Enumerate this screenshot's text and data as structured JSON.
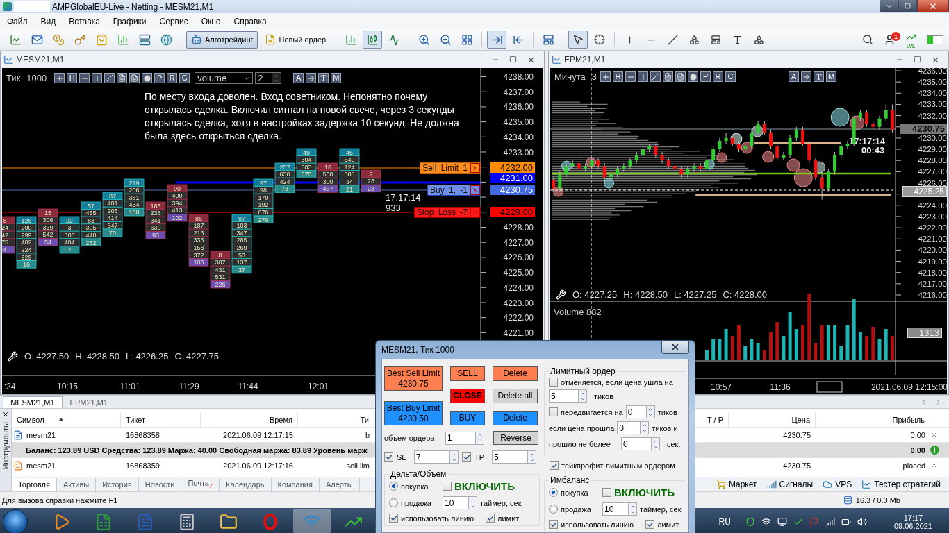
{
  "window": {
    "title": "AMPGlobalEU-Live - Netting - MESM21,M1"
  },
  "menu": [
    "Файл",
    "Вид",
    "Вставка",
    "Графики",
    "Сервис",
    "Окно",
    "Справка"
  ],
  "toolbar": {
    "buttons": [
      {
        "label": "Алготрейдинг",
        "selected": true
      },
      {
        "label": "Новый ордер",
        "selected": false
      }
    ],
    "chart_type": [
      {
        "selected": false
      },
      {
        "selected": true
      },
      {
        "selected": false
      }
    ],
    "scroll": [
      {
        "selected": true
      },
      {
        "selected": false
      }
    ],
    "cursor_tools": [
      {
        "selected": true
      },
      {
        "selected": false
      }
    ],
    "notification_count": "1",
    "level_badge": "LVL"
  },
  "left_chart": {
    "title": "MESM21,M1",
    "timeframe_label": "Тик",
    "timeframe_value": "1000",
    "tools": [
      {
        "kind": "plus"
      },
      {
        "kind": "letter",
        "label": "H"
      },
      {
        "kind": "hline"
      },
      {
        "kind": "vline"
      },
      {
        "kind": "diag"
      },
      {
        "kind": "lines"
      },
      {
        "kind": "lines"
      },
      {
        "kind": "dot"
      },
      {
        "kind": "letter",
        "label": "P"
      },
      {
        "kind": "letter",
        "label": "R"
      },
      {
        "kind": "letter",
        "label": "C"
      }
    ],
    "indicator": "volume",
    "indicator_value": "2",
    "tools_right": [
      {
        "kind": "letter",
        "label": "A"
      },
      {
        "kind": "arrow"
      },
      {
        "kind": "ibeam"
      },
      {
        "kind": "letter",
        "label": "M"
      }
    ],
    "note": "По месту входа доволен. Вход советником. Непонятно почему открылась сделка. Включил сигнал на новой свече, через 3 секунды открылась сделка, хотя в настройках задержка 10 секунд. Не должна была здесь открыться сделка.",
    "price_axis": [
      [
        "4238.00",
        "4237.00",
        "4236.00",
        "4235.00",
        "4234.00",
        "4233.00"
      ],
      [
        "4228.00",
        "4227.00",
        "4226.00",
        "4225.00",
        "4224.00",
        "4223.00",
        "4222.00",
        "4221.00"
      ]
    ],
    "order_lines": [
      {
        "kind": "sell_limit",
        "label": "Sell Limit 1",
        "price": "4232.00"
      },
      {
        "kind": "buy",
        "label": "Buy 1, -1",
        "price": "4230.75"
      },
      {
        "kind": "stop_loss",
        "label": "Stop Loss -7",
        "price": "4229.00"
      }
    ],
    "extra_tag": "4231.00",
    "clock": "17:17:14",
    "tick_volume": "933",
    "ohlc": [
      "O: 4227.50",
      "H: 4228.50",
      "L: 4226.25",
      "C: 4227.75"
    ],
    "time_axis": [
      ":24",
      "10:15",
      "11:01",
      "11:29",
      "11:44",
      "12:01"
    ],
    "clusters": [
      {
        "kind": "down",
        "cells": [
          "8",
          "24",
          "42",
          "75",
          "4"
        ]
      },
      {
        "kind": "up",
        "cells": [
          "126",
          "200",
          "299",
          "402",
          "224",
          "229",
          "16"
        ]
      },
      {
        "kind": "down",
        "cells": [
          "15",
          "306",
          "339",
          "542",
          "54"
        ]
      },
      {
        "kind": "up",
        "cells": [
          "22",
          "3",
          "305",
          "404",
          "7"
        ]
      },
      {
        "kind": "up",
        "cells": [
          "57",
          "455",
          "83",
          "305",
          "448",
          "232"
        ]
      },
      {
        "kind": "up",
        "cells": [
          "87",
          "401",
          "206",
          "414",
          "347",
          "70"
        ]
      },
      {
        "kind": "up",
        "cells": [
          "219",
          "206",
          "381",
          "434",
          "108"
        ]
      },
      {
        "kind": "down",
        "cells": [
          "185",
          "238",
          "341",
          "630",
          "93"
        ]
      },
      {
        "kind": "down",
        "cells": [
          "90",
          "400",
          "394",
          "413",
          "102"
        ]
      },
      {
        "kind": "down",
        "cells": [
          "86",
          "187",
          "216",
          "336",
          "158",
          "372",
          "106"
        ]
      },
      {
        "kind": "down",
        "cells": [
          "8",
          "307",
          "431",
          "531",
          "226"
        ]
      },
      {
        "kind": "up",
        "cells": [
          "97",
          "103",
          "347",
          "285",
          "269",
          "53",
          "137",
          "37"
        ]
      },
      {
        "kind": "up",
        "cells": [
          "97",
          "98",
          "170",
          "192",
          "676",
          "276"
        ]
      },
      {
        "kind": "up",
        "cells": [
          "257",
          "630",
          "424",
          "73"
        ]
      },
      {
        "kind": "up",
        "cells": [
          "49",
          "304",
          "503",
          "575"
        ]
      },
      {
        "kind": "down",
        "cells": [
          "16",
          "560",
          "300",
          "457"
        ]
      },
      {
        "kind": "up",
        "cells": [
          "45",
          "540",
          "124",
          "388",
          "34",
          "21"
        ]
      },
      {
        "kind": "down",
        "cells": [
          "2",
          "23",
          "23"
        ]
      }
    ]
  },
  "right_chart": {
    "title": "EPM21,M1",
    "timeframe_label": "Минута",
    "timeframe_value": "3",
    "tools": [
      {
        "kind": "plus"
      },
      {
        "kind": "letter",
        "label": "H"
      },
      {
        "kind": "hline"
      },
      {
        "kind": "vline"
      },
      {
        "kind": "diag"
      },
      {
        "kind": "lines"
      },
      {
        "kind": "lines"
      },
      {
        "kind": "dot"
      },
      {
        "kind": "letter",
        "label": "P"
      },
      {
        "kind": "letter",
        "label": "R"
      },
      {
        "kind": "letter",
        "label": "C"
      }
    ],
    "tools_right": [
      {
        "kind": "letter",
        "label": "A"
      },
      {
        "kind": "arrow"
      },
      {
        "kind": "ibeam"
      },
      {
        "kind": "letter",
        "label": "M"
      }
    ],
    "last_price": "4230.75",
    "cursor_price": "4225.25",
    "clock": "17:17:14",
    "timer": "00:43",
    "ohlc": [
      "O: 4227.25",
      "H: 4228.50",
      "L: 4227.25",
      "C: 4228.00"
    ],
    "volume_label": "Volume 882",
    "volume_tag": "1313",
    "time_axis": [
      "10:57",
      "11:36"
    ],
    "time_stamp": "2021.06.09 12:15:00",
    "chart_data": {
      "type": "candlestick",
      "ylim": [
        4216,
        4236
      ],
      "yticks": [
        {
          "value": 4236,
          "label": "4236.00"
        },
        {
          "value": 4235,
          "label": "4235.00"
        },
        {
          "value": 4234,
          "label": "4234.00"
        },
        {
          "value": 4233,
          "label": "4233.00"
        },
        {
          "value": 4232,
          "label": "4232.00"
        },
        {
          "value": 4230,
          "label": "4230.00"
        },
        {
          "value": 4229,
          "label": "4229.00"
        },
        {
          "value": 4228,
          "label": "4228.00"
        },
        {
          "value": 4227,
          "label": "4227.00"
        },
        {
          "value": 4226,
          "label": "4226.00"
        },
        {
          "value": 4224,
          "label": "4224.00"
        },
        {
          "value": 4223,
          "label": "4223.00"
        },
        {
          "value": 4222,
          "label": "4222.00"
        },
        {
          "value": 4221,
          "label": "4221.00"
        },
        {
          "value": 4220,
          "label": "4220.00"
        },
        {
          "value": 4219,
          "label": "4219.00"
        },
        {
          "value": 4218,
          "label": "4218.00"
        },
        {
          "value": 4217,
          "label": "4217.00"
        },
        {
          "value": 4216,
          "label": "4216.00"
        }
      ],
      "categories": [
        null,
        null,
        null,
        null,
        null,
        null,
        null,
        null,
        null,
        null,
        null,
        null,
        null,
        null,
        null,
        null,
        null,
        null,
        null,
        null,
        null,
        null,
        null,
        null,
        null,
        null,
        null,
        null,
        null,
        null,
        null,
        null,
        null,
        null,
        null,
        null,
        null,
        null,
        null,
        null,
        null,
        null,
        null,
        null,
        null,
        null,
        null,
        null,
        null,
        null,
        null,
        null,
        null,
        null
      ],
      "ohlc": [
        [
          4226.25,
          4226.5,
          4225.25,
          4225.5
        ],
        [
          4225.5,
          4227,
          4225.25,
          4226.75
        ],
        [
          4226.75,
          4227.75,
          4226.5,
          4227.5
        ],
        [
          4227.5,
          4228,
          4227.25,
          4227.75
        ],
        [
          4227.75,
          4228,
          4227,
          4227.25
        ],
        [
          4227.25,
          4227.75,
          4227,
          4227.5
        ],
        [
          4227.5,
          4228.25,
          4227.25,
          4228
        ],
        [
          4228,
          4228.25,
          4227.25,
          4227.5
        ],
        [
          4227.5,
          4227.75,
          4226,
          4226.5
        ],
        [
          4226.5,
          4227,
          4226.25,
          4226.75
        ],
        [
          4226.75,
          4227.5,
          4226.5,
          4227.25
        ],
        [
          4227.25,
          4227.75,
          4227,
          4227.5
        ],
        [
          4227.5,
          4228.25,
          4227.25,
          4228
        ],
        [
          4228,
          4228.75,
          4227.75,
          4228.5
        ],
        [
          4228.5,
          4229.25,
          4228.25,
          4229
        ],
        [
          4229,
          4229.5,
          4228.75,
          4229.25
        ],
        [
          4229.25,
          4229.5,
          4228.25,
          4228.5
        ],
        [
          4228.5,
          4228.75,
          4227.75,
          4228
        ],
        [
          4228,
          4228.25,
          4227.25,
          4227.5
        ],
        [
          4227.5,
          4227.75,
          4226.75,
          4227.25
        ],
        [
          4227.25,
          4227.5,
          4226.5,
          4226.75
        ],
        [
          4226.75,
          4227.5,
          4226.5,
          4227.25
        ],
        [
          4227.25,
          4227.75,
          4227,
          4227.5
        ],
        [
          4227.5,
          4227.75,
          4227,
          4227.25
        ],
        [
          4227.25,
          4228.25,
          4227,
          4228
        ],
        [
          4228,
          4229.25,
          4227.75,
          4229
        ],
        [
          4229,
          4230,
          4228.75,
          4229.75
        ],
        [
          4229.75,
          4230.5,
          4229.5,
          4230
        ],
        [
          4230,
          4230.25,
          4229.25,
          4229.5
        ],
        [
          4229.5,
          4229.75,
          4228.75,
          4229
        ],
        [
          4229,
          4229.5,
          4228.75,
          4229.25
        ],
        [
          4229.25,
          4230.75,
          4229,
          4230.5
        ],
        [
          4230.5,
          4231.5,
          4230.25,
          4231.25
        ],
        [
          4231.25,
          4231.5,
          4230.25,
          4230.5
        ],
        [
          4230.5,
          4230.75,
          4229,
          4229.25
        ],
        [
          4229.25,
          4229.5,
          4228,
          4228.25
        ],
        [
          4228.25,
          4228.75,
          4228,
          4228.5
        ],
        [
          4228.5,
          4230.25,
          4228.25,
          4230
        ],
        [
          4230,
          4231,
          4229.75,
          4230.75
        ],
        [
          4230.75,
          4231,
          4229.25,
          4229.5
        ],
        [
          4229.5,
          4229.75,
          4227.75,
          4228
        ],
        [
          4228,
          4228.25,
          4226.25,
          4226.5
        ],
        [
          4226.5,
          4226.75,
          4224.5,
          4225.5
        ],
        [
          4225.5,
          4227.25,
          4225.25,
          4227
        ],
        [
          4227,
          4228.75,
          4226.75,
          4228.5
        ],
        [
          4228.5,
          4229.5,
          4228.25,
          4229.25
        ],
        [
          4229.25,
          4229.75,
          4229,
          4229.5
        ],
        [
          4229.5,
          4232,
          4229.25,
          4231.75
        ],
        [
          4231.75,
          4232.5,
          4231.5,
          4232.25
        ],
        [
          4232.25,
          4232.5,
          4231,
          4231.25
        ],
        [
          4231.25,
          4231.5,
          4230.75,
          4231
        ],
        [
          4231,
          4232,
          4230.75,
          4231.75
        ],
        [
          4231.75,
          4233,
          4231.5,
          4232.5
        ],
        [
          4232.5,
          4233,
          4230.5,
          4230.75
        ]
      ]
    }
  },
  "chart_tabs": [
    {
      "label": "MESM21,M1",
      "selected": true
    },
    {
      "label": "EPM21,M1",
      "selected": false
    }
  ],
  "terminal": {
    "side_label": "Инструменты",
    "columns": [
      "Символ",
      "Тикет",
      "Время",
      "Ти",
      "T / P",
      "Цена",
      "Прибыль"
    ],
    "rows": [
      {
        "kind": "position",
        "symbol": "mesm21",
        "ticket": "16868358",
        "time": "2021.06.09 12:17:15",
        "type": "b",
        "price": "4230.75",
        "profit": "0.00"
      },
      {
        "kind": "balance",
        "text": "Баланс: 123.89 USD  Средства: 123.89  Маржа: 40.00  Свободная маржа: 83.89  Уровень марж",
        "profit": "0.00"
      },
      {
        "kind": "order",
        "symbol": "mesm21",
        "ticket": "16868359",
        "time": "2021.06.09 12:17:16",
        "type": "sell lim",
        "price": "4230.75",
        "profit": "placed"
      }
    ],
    "tabs": [
      {
        "label": "Торговля",
        "selected": true
      },
      {
        "label": "Активы",
        "selected": false
      },
      {
        "label": "История",
        "selected": false
      },
      {
        "label": "Новости",
        "selected": false
      },
      {
        "label": "Почта$_{7}$",
        "selected": false
      },
      {
        "label": "Календарь",
        "selected": false
      },
      {
        "label": "Компания",
        "selected": false
      },
      {
        "label": "Алерты",
        "selected": false
      }
    ],
    "links": [
      "Маркет",
      "Сигналы",
      "VPS",
      "Тестер стратегий"
    ]
  },
  "status_bar": {
    "help": "Для вызова справки нажмите F1",
    "traffic": "16.3 / 0.0 Mb"
  },
  "taskbar": {
    "language": "RU",
    "time": "17:17",
    "date": "09.06.2021"
  },
  "dialog": {
    "title": "MESM21, Тик  1000",
    "columns": [
      [
        {
          "kind": "sell",
          "label": "Best Sell Limit",
          "price": "4230.75"
        },
        {
          "kind": "buy",
          "label": "Best Buy Limit",
          "price": "4230.50"
        }
      ],
      [
        {
          "kind": "sell",
          "label": "SELL"
        },
        {
          "kind": "close",
          "label": "CLOSE"
        },
        {
          "kind": "buy",
          "label": "BUY"
        }
      ],
      [
        {
          "kind": "sell",
          "label": "Delete"
        },
        {
          "kind": "neutral",
          "label": "Delete all"
        },
        {
          "kind": "buy",
          "label": "Delete"
        }
      ]
    ],
    "volume": {
      "label": "объем ордера",
      "value": "1"
    },
    "reverse": "Reverse",
    "sl": {
      "label": "SL",
      "checked": true,
      "value": "7"
    },
    "tp": {
      "label": "TP",
      "checked": true,
      "value": "5"
    },
    "limit_order": {
      "title": "Лимитный ордер",
      "cancel": {
        "checked": false,
        "label": "отменяется, если цена ушла на",
        "value": "5",
        "unit": "тиков"
      },
      "move": {
        "checked": false,
        "label": "передвигается на",
        "value": "0",
        "unit": "тиков"
      },
      "passed": {
        "label": "если цена прошла",
        "value": "0",
        "unit": "тиков и"
      },
      "within": {
        "label": "прошло не более",
        "value": "0",
        "unit": "сек."
      }
    },
    "tp_limit": {
      "checked": true,
      "label": "тейкпрофит лимитным ордером"
    },
    "panels": [
      {
        "title": "Дельта/Объем",
        "radios": [
          {
            "label": "покупка",
            "selected": true
          },
          {
            "label": "продажа",
            "selected": false
          }
        ],
        "enable": {
          "label": "ВКЛЮЧИТЬ",
          "checked": false
        },
        "timer": {
          "value": "10",
          "label": "таймер, сек"
        },
        "use_line": {
          "label": "использовать линию",
          "checked": true
        },
        "limit": {
          "label": "лимит",
          "checked": true
        }
      },
      {
        "title": "Имбаланс",
        "radios": [
          {
            "label": "покупка",
            "selected": true
          },
          {
            "label": "продажа",
            "selected": false
          }
        ],
        "enable": {
          "label": "ВКЛЮЧИТЬ",
          "checked": false
        },
        "timer": {
          "value": "10",
          "label": "таймер, сек"
        },
        "use_line": {
          "label": "использовать линию",
          "checked": true
        },
        "limit": {
          "label": "лимит",
          "checked": true
        }
      }
    ]
  }
}
